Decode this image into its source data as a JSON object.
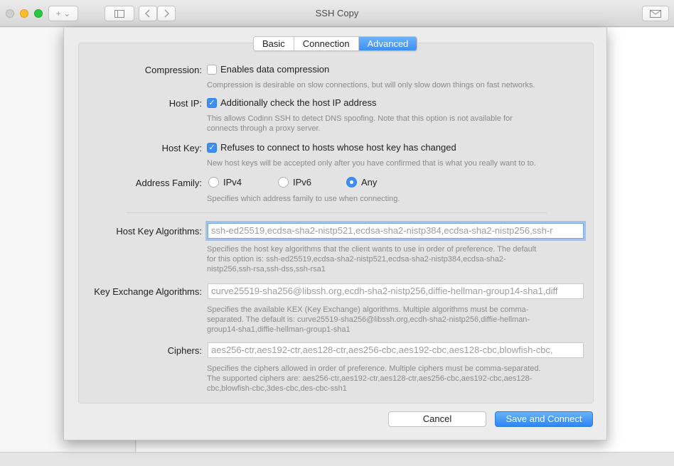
{
  "window": {
    "title": "SSH Copy",
    "new_tab_label": "+ ⌄",
    "sidebar_icon": "sidebar-icon",
    "back_icon": "chevron-left-icon",
    "forward_icon": "chevron-right-icon",
    "share_icon": "envelope-icon"
  },
  "tabs": [
    {
      "label": "Basic",
      "active": false
    },
    {
      "label": "Connection",
      "active": false
    },
    {
      "label": "Advanced",
      "active": true
    }
  ],
  "compression": {
    "label": "Compression:",
    "option": "Enables data compression",
    "checked": false,
    "help": "Compression is desirable on slow connections, but will only slow down things on fast networks."
  },
  "host_ip": {
    "label": "Host IP:",
    "option": "Additionally check the host IP address",
    "checked": true,
    "help1": "This allows Codinn SSH to detect DNS spoofing. Note that this option is not available for",
    "help2": "connects through a proxy server."
  },
  "host_key": {
    "label": "Host Key:",
    "option": "Refuses to connect to hosts whose host key has changed",
    "checked": true,
    "help": "New host keys will be accepted only after you have confirmed that is what you really want to to."
  },
  "address_family": {
    "label": "Address Family:",
    "options": [
      "IPv4",
      "IPv6",
      "Any"
    ],
    "selected": "Any",
    "help": "Specifies which address family to use when connecting."
  },
  "host_key_algorithms": {
    "label": "Host Key Algorithms:",
    "placeholder": "ssh-ed25519,ecdsa-sha2-nistp521,ecdsa-sha2-nistp384,ecdsa-sha2-nistp256,ssh-r",
    "help1": "Specifies the host key algorithms that the client wants to use in order of preference. The default",
    "help2": "for this option is: ssh-ed25519,ecdsa-sha2-nistp521,ecdsa-sha2-nistp384,ecdsa-sha2-",
    "help3": "nistp256,ssh-rsa,ssh-dss,ssh-rsa1"
  },
  "kex_algorithms": {
    "label": "Key Exchange Algorithms:",
    "placeholder": "curve25519-sha256@libssh.org,ecdh-sha2-nistp256,diffie-hellman-group14-sha1,diff",
    "help1": "Specifies the available KEX (Key Exchange) algorithms. Multiple algorithms must be comma-",
    "help2": "separated. The default is: curve25519-sha256@libssh.org,ecdh-sha2-nistp256,diffie-hellman-",
    "help3": "group14-sha1,diffie-hellman-group1-sha1"
  },
  "ciphers": {
    "label": "Ciphers:",
    "placeholder": "aes256-ctr,aes192-ctr,aes128-ctr,aes256-cbc,aes192-cbc,aes128-cbc,blowfish-cbc,",
    "help1": "Specifies the ciphers allowed in order of preference. Multiple ciphers must be comma-separated.",
    "help2": "The supported ciphers are: aes256-ctr,aes192-ctr,aes128-ctr,aes256-cbc,aes192-cbc,aes128-",
    "help3": "cbc,blowfish-cbc,3des-cbc,des-cbc-ssh1"
  },
  "buttons": {
    "cancel": "Cancel",
    "save": "Save and Connect"
  }
}
